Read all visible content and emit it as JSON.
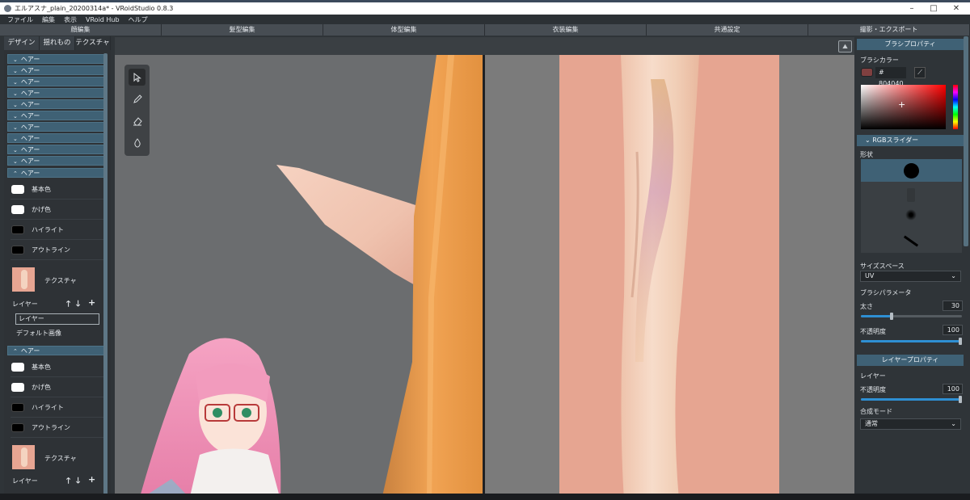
{
  "window": {
    "title": "エルアスナ_plain_20200314a* - VRoidStudio 0.8.3",
    "controls": [
      "–",
      "□",
      "✕"
    ]
  },
  "menu": [
    "ファイル",
    "編集",
    "表示",
    "VRoid Hub",
    "ヘルプ"
  ],
  "main_tabs": [
    "顔編集",
    "髪型編集",
    "体型編集",
    "衣装編集",
    "共通設定",
    "撮影・エクスポート"
  ],
  "left": {
    "subtabs": [
      "デザイン",
      "揺れもの",
      "テクスチャ"
    ],
    "hair_group_label": "ヘアー",
    "color_rows": [
      "基本色",
      "かげ色",
      "ハイライト",
      "アウトライン"
    ],
    "texture_label": "テクスチャ",
    "layer_label": "レイヤー",
    "layer_buttons": [
      "🡑",
      "🡓",
      "+"
    ],
    "layer_item": "レイヤー",
    "default_image": "デフォルト画像",
    "colors": {
      "base": "#ffffff",
      "shadow": "#ffffff",
      "highlight": "#000000",
      "outline": "#000000",
      "header": "#3f6175",
      "accent": "#2e8fd3"
    }
  },
  "toolbox": {
    "tools": [
      "select-icon",
      "pencil-icon",
      "eraser-icon",
      "dropper-icon"
    ]
  },
  "right": {
    "brush_header": "ブラシプロパティ",
    "brush_color_label": "ブラシカラー",
    "brush_hex": "# 804040",
    "brush_color": "#804040",
    "rgb_slider_label": "RGBスライダー",
    "shape_label": "形状",
    "size_space_label": "サイズスペース",
    "size_space_value": "UV",
    "brush_param_label": "ブラシパラメータ",
    "thickness_label": "太さ",
    "thickness_value": "30",
    "thickness_fraction": 0.3,
    "opacity_label": "不透明度",
    "opacity_value": "100",
    "layer_header": "レイヤープロパティ",
    "layer_label": "レイヤー",
    "layer_opacity_label": "不透明度",
    "layer_opacity_value": "100",
    "blend_label": "合成モード",
    "blend_value": "通常"
  }
}
